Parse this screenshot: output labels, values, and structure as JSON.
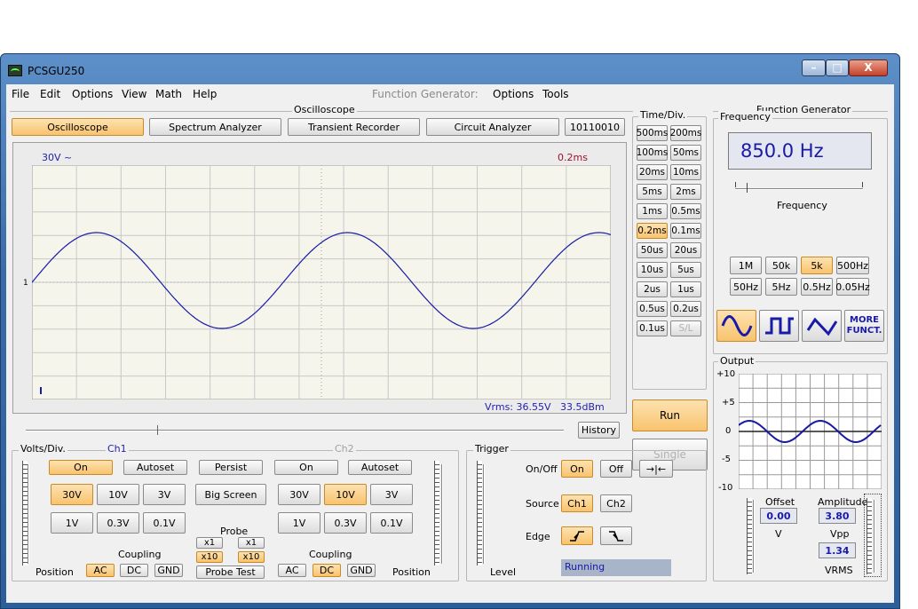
{
  "window": {
    "title": "PCSGU250",
    "minimize": "–",
    "maximize": "□",
    "close": "X"
  },
  "menu": {
    "items": [
      "File",
      "Edit",
      "Options",
      "View",
      "Math",
      "Help"
    ],
    "fg_label": "Function Generator:",
    "fg_items": [
      "Options",
      "Tools"
    ]
  },
  "scope": {
    "section_title": "Oscilloscope",
    "tabs": [
      "Oscilloscope",
      "Spectrum Analyzer",
      "Transient Recorder",
      "Circuit Analyzer",
      "10110010"
    ],
    "ch1_volts": "30V ~",
    "timebase": "0.2ms",
    "marker": "1",
    "vrms": "Vrms: 36.55V",
    "dbm": "33.5dBm",
    "history": "History"
  },
  "timediv": {
    "title": "Time/Div.",
    "buttons": [
      [
        "500ms",
        "200ms"
      ],
      [
        "100ms",
        "50ms"
      ],
      [
        "20ms",
        "10ms"
      ],
      [
        "5ms",
        "2ms"
      ],
      [
        "1ms",
        "0.5ms"
      ],
      [
        "0.2ms",
        "0.1ms"
      ],
      [
        "50us",
        "20us"
      ],
      [
        "10us",
        "5us"
      ],
      [
        "2us",
        "1us"
      ],
      [
        "0.5us",
        "0.2us"
      ],
      [
        "0.1us",
        "S/L"
      ]
    ],
    "selected": "0.2ms",
    "run": "Run",
    "single": "Single"
  },
  "volts": {
    "title": "Volts/Div.",
    "ch1": "Ch1",
    "ch2": "Ch2",
    "on": "On",
    "autoset": "Autoset",
    "persist": "Persist",
    "big_screen": "Big Screen",
    "ranges_top": [
      "30V",
      "10V",
      "3V"
    ],
    "ranges_bottom": [
      "1V",
      "0.3V",
      "0.1V"
    ],
    "ch1_selected": "30V",
    "ch2_selected": "10V",
    "probe": "Probe",
    "x1": "x1",
    "x10": "x10",
    "probe_test": "Probe Test",
    "coupling": "Coupling",
    "ac": "AC",
    "dc": "DC",
    "gnd": "GND",
    "ch1_coupling": "AC",
    "ch2_coupling": "DC",
    "position": "Position"
  },
  "trigger": {
    "title": "Trigger",
    "onoff": "On/Off",
    "on": "On",
    "off": "Off",
    "arrows": "→|←",
    "source": "Source",
    "ch1": "Ch1",
    "ch2": "Ch2",
    "edge": "Edge",
    "level": "Level",
    "status": "Running"
  },
  "fg": {
    "title": "Function Generator",
    "freq_title": "Frequency",
    "freq_value": "850.0 Hz",
    "freq_label": "Frequency",
    "range_row1": [
      "1M",
      "50k",
      "5k",
      "500Hz"
    ],
    "range_row2": [
      "50Hz",
      "5Hz",
      "0.5Hz",
      "0.05Hz"
    ],
    "range_selected": "5k",
    "more": "MORE FUNCT.",
    "output_title": "Output",
    "y_ticks": [
      "+10",
      "+5",
      "0",
      "-5",
      "-10"
    ],
    "offset_label": "Offset",
    "offset_value": "0.00",
    "offset_unit": "V",
    "amp_label": "Amplitude",
    "amp_value": "3.80",
    "amp_unit": "Vpp",
    "vrms_value": "1.34",
    "vrms_unit": "VRMS"
  }
}
